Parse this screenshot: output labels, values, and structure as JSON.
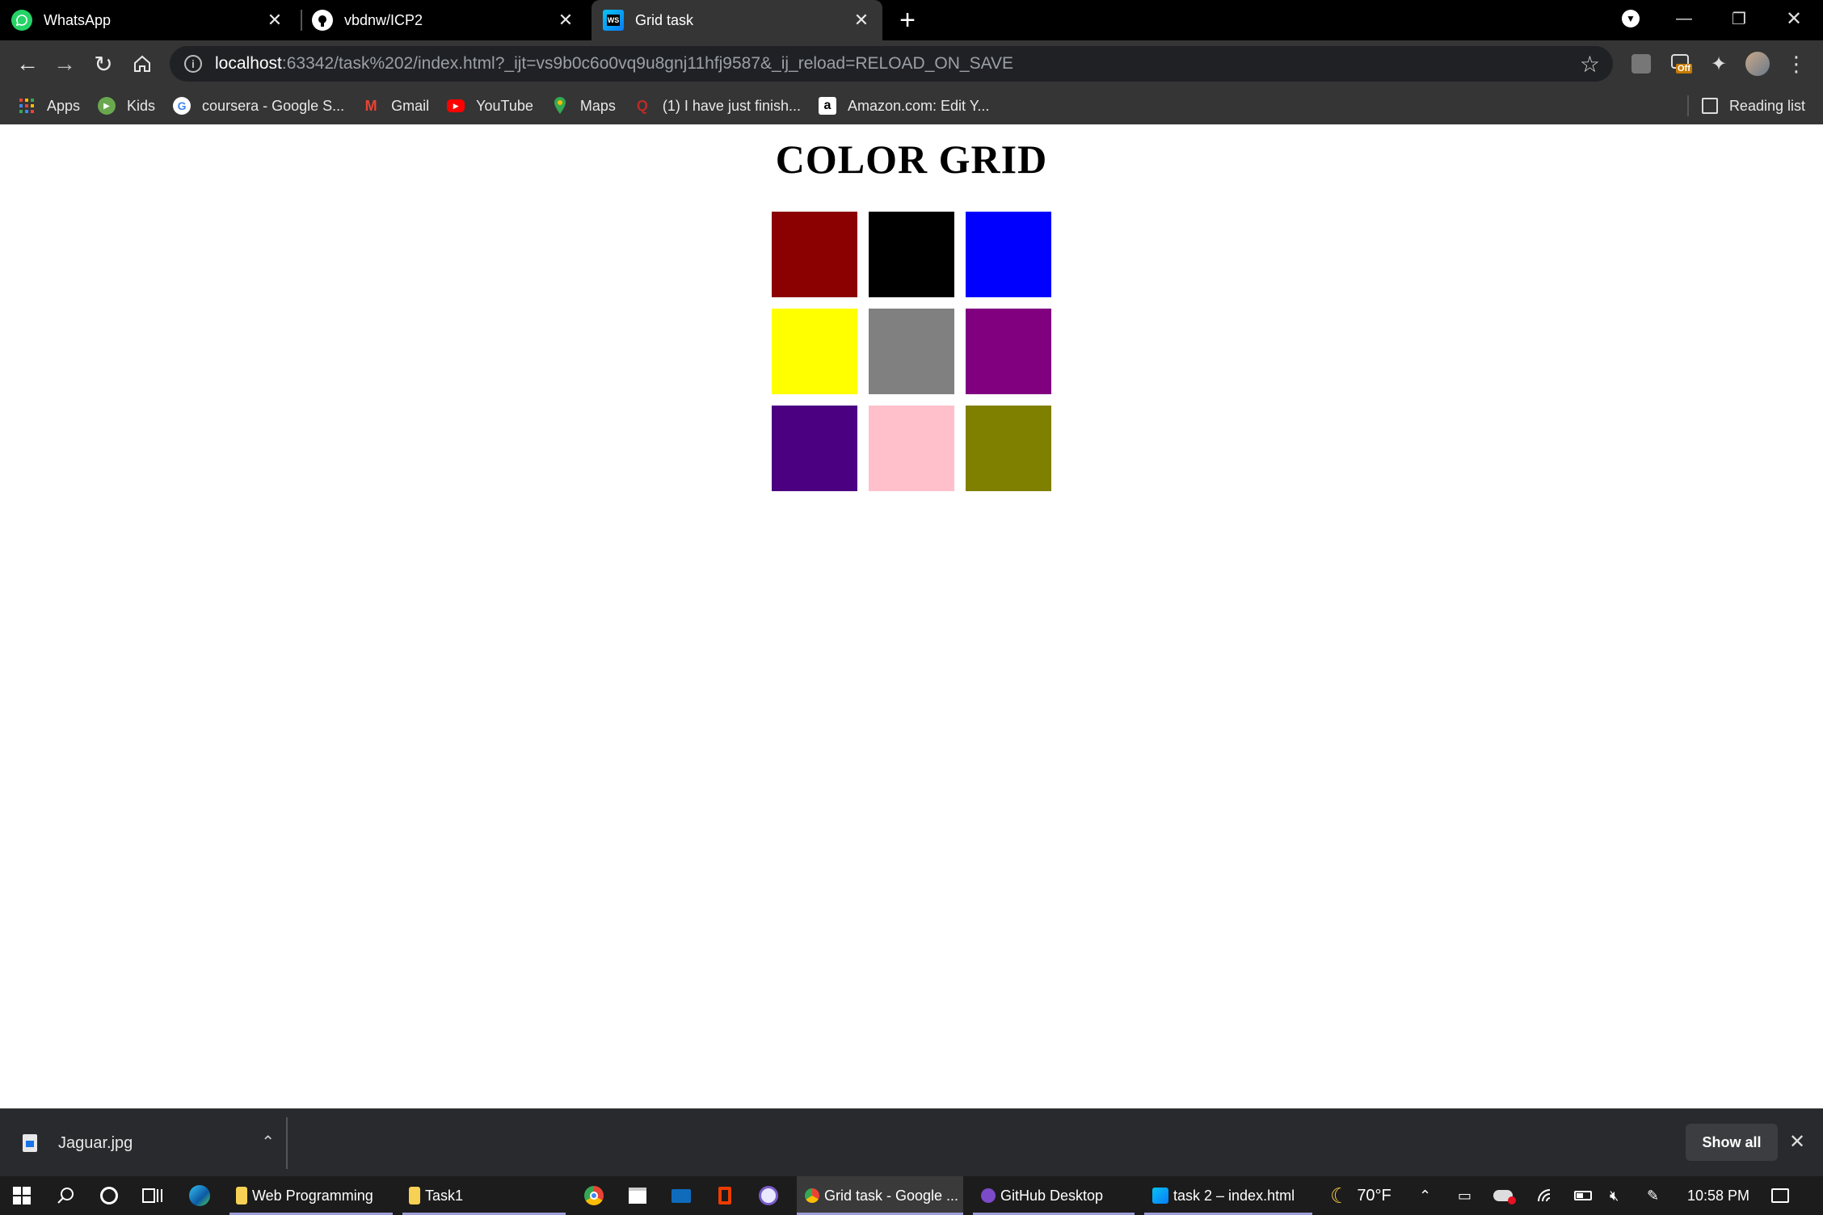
{
  "browser": {
    "tabs": [
      {
        "title": "WhatsApp",
        "icon": "whatsapp-icon",
        "active": false
      },
      {
        "title": "vbdnw/ICP2",
        "icon": "github-icon",
        "active": false
      },
      {
        "title": "Grid task",
        "icon": "webstorm-icon",
        "active": true
      }
    ],
    "url_host": "localhost",
    "url_rest": ":63342/task%202/index.html?_ijt=vs9b0c6o0vq9u8gnj11hfj9587&_ij_reload=RELOAD_ON_SAVE",
    "extension_badge": "Off",
    "bookmarks": [
      {
        "label": "Apps",
        "icon": "apps-grid-icon"
      },
      {
        "label": "Kids",
        "icon": "play-icon"
      },
      {
        "label": "coursera - Google S...",
        "icon": "google-icon"
      },
      {
        "label": "Gmail",
        "icon": "gmail-icon"
      },
      {
        "label": "YouTube",
        "icon": "youtube-icon"
      },
      {
        "label": "Maps",
        "icon": "maps-pin-icon"
      },
      {
        "label": "(1) I have just finish...",
        "icon": "quora-icon"
      },
      {
        "label": "Amazon.com: Edit Y...",
        "icon": "amazon-icon"
      }
    ],
    "reading_list": "Reading list"
  },
  "page": {
    "title": "COLOR GRID",
    "cells": [
      {
        "color": "#8b0000"
      },
      {
        "color": "#000000"
      },
      {
        "color": "#0000ff"
      },
      {
        "color": "#ffff00"
      },
      {
        "color": "#808080"
      },
      {
        "color": "#800080"
      },
      {
        "color": "#4b0082"
      },
      {
        "color": "#ffc0cb"
      },
      {
        "color": "#808000"
      }
    ]
  },
  "downloads": {
    "file": "Jaguar.jpg",
    "show_all": "Show all"
  },
  "taskbar": {
    "apps": [
      {
        "label": "Web Programming",
        "icon": "folder-icon"
      },
      {
        "label": "Task1",
        "icon": "folder-icon"
      },
      {
        "label": "Grid task - Google ...",
        "icon": "chrome-icon"
      },
      {
        "label": "GitHub Desktop",
        "icon": "github-desktop-icon"
      },
      {
        "label": "task 2 – index.html",
        "icon": "webstorm-icon"
      }
    ],
    "weather": "70°F",
    "time": "10:58 PM"
  }
}
